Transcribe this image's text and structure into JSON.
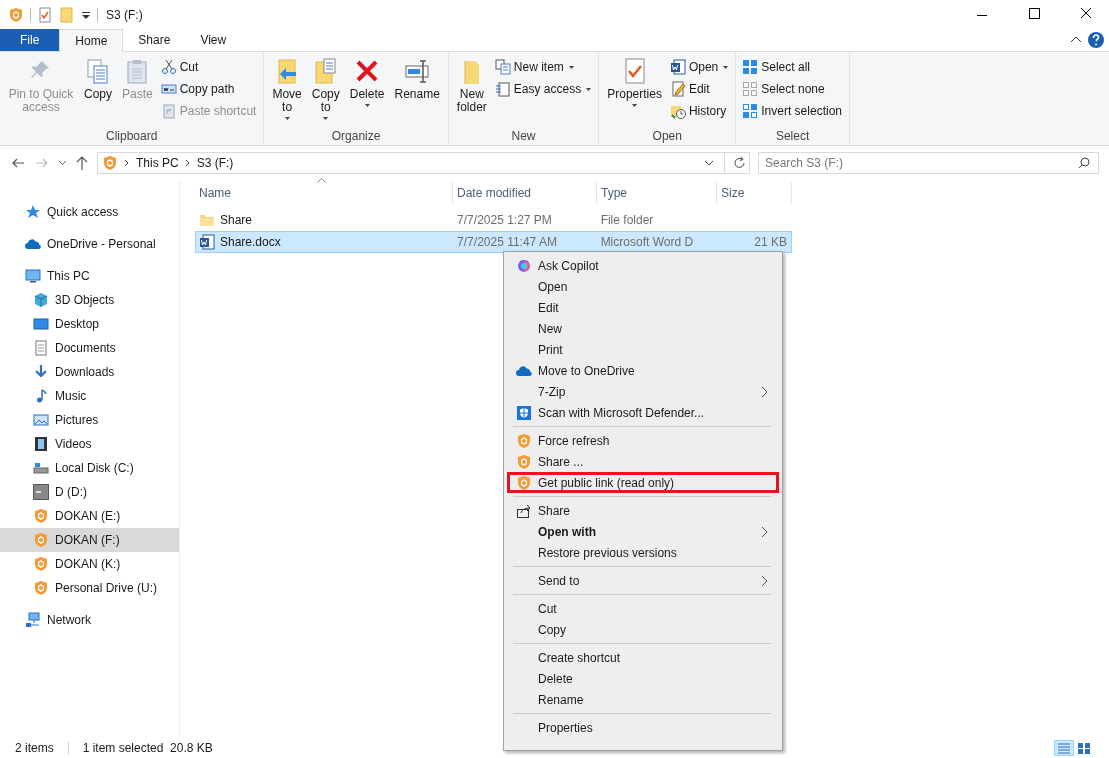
{
  "window": {
    "title": "S3 (F:)"
  },
  "ribbon_tabs": [
    {
      "label": "File",
      "kind": "file",
      "selected": false
    },
    {
      "label": "Home",
      "kind": "tab",
      "selected": true
    },
    {
      "label": "Share",
      "kind": "tab",
      "selected": false
    },
    {
      "label": "View",
      "kind": "tab",
      "selected": false
    }
  ],
  "ribbon_groups": [
    {
      "label": "Clipboard",
      "large": [
        {
          "label": "Pin to Quick access",
          "disabled": true,
          "dropdown": false
        },
        {
          "label": "Copy",
          "disabled": false,
          "dropdown": false
        },
        {
          "label": "Paste",
          "disabled": true,
          "dropdown": false
        }
      ],
      "small": [
        {
          "label": "Cut",
          "disabled": false,
          "dropdown": false
        },
        {
          "label": "Copy path",
          "disabled": false,
          "dropdown": false
        },
        {
          "label": "Paste shortcut",
          "disabled": true,
          "dropdown": false
        }
      ]
    },
    {
      "label": "Organize",
      "large": [
        {
          "label": "Move to",
          "disabled": false,
          "dropdown": true
        },
        {
          "label": "Copy to",
          "disabled": false,
          "dropdown": true
        },
        {
          "label": "Delete",
          "disabled": false,
          "dropdown": true
        },
        {
          "label": "Rename",
          "disabled": false,
          "dropdown": false
        }
      ]
    },
    {
      "label": "New",
      "large": [
        {
          "label": "New folder",
          "disabled": false,
          "dropdown": false
        }
      ],
      "small": [
        {
          "label": "New item",
          "disabled": false,
          "dropdown": true
        },
        {
          "label": "Easy access",
          "disabled": false,
          "dropdown": true
        }
      ]
    },
    {
      "label": "Open",
      "large": [
        {
          "label": "Properties",
          "disabled": false,
          "dropdown": true
        }
      ],
      "small": [
        {
          "label": "Open",
          "disabled": false,
          "dropdown": true
        },
        {
          "label": "Edit",
          "disabled": false,
          "dropdown": false
        },
        {
          "label": "History",
          "disabled": false,
          "dropdown": false
        }
      ]
    },
    {
      "label": "Select",
      "small": [
        {
          "label": "Select all",
          "disabled": false,
          "dropdown": false
        },
        {
          "label": "Select none",
          "disabled": false,
          "dropdown": false
        },
        {
          "label": "Invert selection",
          "disabled": false,
          "dropdown": false
        }
      ]
    }
  ],
  "address_bar": {
    "path": [
      "This PC",
      "S3 (F:)"
    ]
  },
  "search": {
    "placeholder": "Search S3 (F:)"
  },
  "sidebar": {
    "items": [
      {
        "label": "Quick access",
        "selected": false
      },
      {
        "label": "OneDrive - Personal",
        "selected": false
      },
      {
        "label": "This PC",
        "selected": false,
        "children": [
          {
            "label": "3D Objects",
            "selected": false
          },
          {
            "label": "Desktop",
            "selected": false
          },
          {
            "label": "Documents",
            "selected": false
          },
          {
            "label": "Downloads",
            "selected": false
          },
          {
            "label": "Music",
            "selected": false
          },
          {
            "label": "Pictures",
            "selected": false
          },
          {
            "label": "Videos",
            "selected": false
          },
          {
            "label": "Local Disk (C:)",
            "selected": false
          },
          {
            "label": "D (D:)",
            "selected": false
          },
          {
            "label": "DOKAN (E:)",
            "selected": false
          },
          {
            "label": "DOKAN (F:)",
            "selected": true
          },
          {
            "label": "DOKAN (K:)",
            "selected": false
          },
          {
            "label": "Personal Drive (U:)",
            "selected": false
          }
        ]
      },
      {
        "label": "Network",
        "selected": false
      }
    ]
  },
  "file_list": {
    "columns": [
      "Name",
      "Date modified",
      "Type",
      "Size"
    ],
    "rows": [
      {
        "kind": "folder",
        "name": "Share",
        "date": "7/7/2025 1:27 PM",
        "type": "File folder",
        "size": "",
        "selected": false
      },
      {
        "kind": "word",
        "name": "Share.docx",
        "date": "7/7/2025 11:47 AM",
        "type": "Microsoft Word D",
        "size": "21 KB",
        "selected": true
      }
    ]
  },
  "context_menu": {
    "items": [
      {
        "kind": "item",
        "label": "Ask Copilot",
        "bold": false,
        "submenu": false,
        "outlined": false
      },
      {
        "kind": "item",
        "label": "Open",
        "bold": false,
        "submenu": false,
        "outlined": false
      },
      {
        "kind": "item",
        "label": "Edit",
        "bold": false,
        "submenu": false,
        "outlined": false
      },
      {
        "kind": "item",
        "label": "New",
        "bold": false,
        "submenu": false,
        "outlined": false
      },
      {
        "kind": "item",
        "label": "Print",
        "bold": false,
        "submenu": false,
        "outlined": false
      },
      {
        "kind": "item",
        "label": "Move to OneDrive",
        "bold": false,
        "submenu": false,
        "outlined": false
      },
      {
        "kind": "item",
        "label": "7-Zip",
        "bold": false,
        "submenu": true,
        "outlined": false
      },
      {
        "kind": "item",
        "label": "Scan with Microsoft Defender...",
        "bold": false,
        "submenu": false,
        "outlined": false
      },
      {
        "kind": "separator"
      },
      {
        "kind": "item",
        "label": "Force refresh",
        "bold": false,
        "submenu": false,
        "outlined": false
      },
      {
        "kind": "item",
        "label": "Share ...",
        "bold": false,
        "submenu": false,
        "outlined": false
      },
      {
        "kind": "item",
        "label": "Get public link (read only)",
        "bold": false,
        "submenu": false,
        "outlined": true
      },
      {
        "kind": "separator"
      },
      {
        "kind": "item",
        "label": "Share",
        "bold": false,
        "submenu": false,
        "outlined": false
      },
      {
        "kind": "item",
        "label": "Open with",
        "bold": true,
        "submenu": true,
        "outlined": false
      },
      {
        "kind": "item",
        "label": "Restore previous versions",
        "bold": false,
        "submenu": false,
        "outlined": false
      },
      {
        "kind": "separator"
      },
      {
        "kind": "item",
        "label": "Send to",
        "bold": false,
        "submenu": true,
        "outlined": false
      },
      {
        "kind": "separator"
      },
      {
        "kind": "item",
        "label": "Cut",
        "bold": false,
        "submenu": false,
        "outlined": false
      },
      {
        "kind": "item",
        "label": "Copy",
        "bold": false,
        "submenu": false,
        "outlined": false
      },
      {
        "kind": "separator"
      },
      {
        "kind": "item",
        "label": "Create shortcut",
        "bold": false,
        "submenu": false,
        "outlined": false
      },
      {
        "kind": "item",
        "label": "Delete",
        "bold": false,
        "submenu": false,
        "outlined": false
      },
      {
        "kind": "item",
        "label": "Rename",
        "bold": false,
        "submenu": false,
        "outlined": false
      },
      {
        "kind": "separator"
      },
      {
        "kind": "item",
        "label": "Properties",
        "bold": false,
        "submenu": false,
        "outlined": false
      }
    ]
  },
  "status_bar": {
    "item_count": "2 items",
    "selection": "1 item selected  20.8 KB",
    "view_buttons": [
      {
        "kind": "details",
        "selected": true
      },
      {
        "kind": "large_icons",
        "selected": false
      }
    ]
  }
}
